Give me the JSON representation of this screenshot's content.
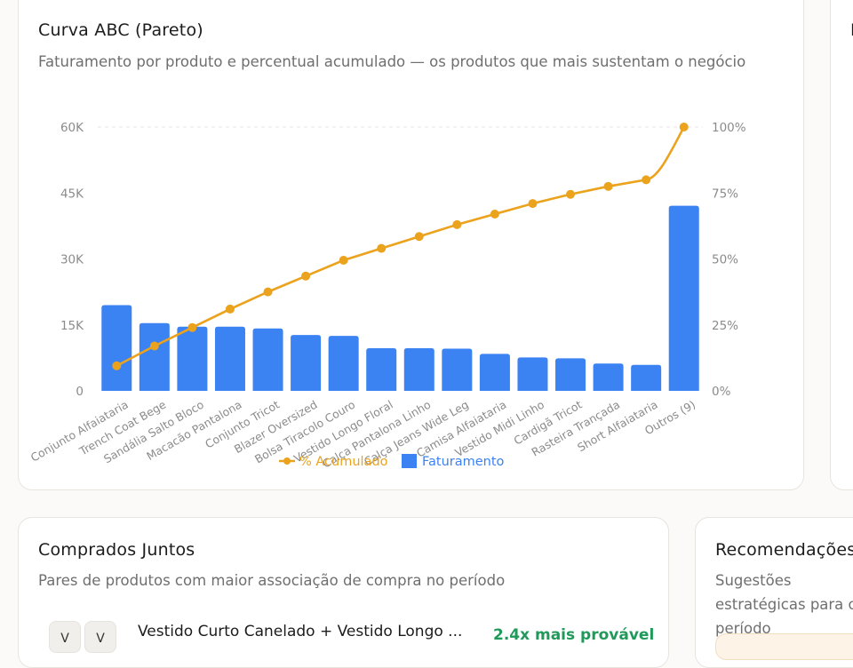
{
  "abc_card": {
    "title": "Curva ABC (Pareto)",
    "subtitle": "Faturamento por produto e percentual acumulado — os produtos que mais sustentam o negócio"
  },
  "right_card": {
    "title": "I"
  },
  "bought_card": {
    "title": "Comprados Juntos",
    "subtitle": "Pares de produtos com maior associação de compra no período",
    "pair": {
      "thumb_a": "V",
      "thumb_b": "V",
      "name": "Vestido Curto Canelado + Vestido Longo ...",
      "lift": "2.4x mais provável"
    }
  },
  "recs_card": {
    "title": "Recomendações",
    "subtitle": "Sugestões estratégicas para o período"
  },
  "colors": {
    "bar": "#3b82f2",
    "line": "#eba21c",
    "axis_text": "#8b8b8b",
    "grid": "#e6e6e6"
  },
  "chart_data": {
    "type": "bar",
    "categories": [
      "Conjunto Alfaiataria",
      "Trench Coat Bege",
      "Sandália Salto Bloco",
      "Macacão Pantalona",
      "Conjunto Tricot",
      "Blazer Oversized",
      "Bolsa Tiracolo Couro",
      "Vestido Longo Floral",
      "Calça Pantalona Linho",
      "Calça Jeans Wide Leg",
      "Camisa Alfaiataria",
      "Vestido Midi Linho",
      "Cardigã Tricot",
      "Rasteira Trançada",
      "Short Alfaiataria",
      "Outros (9)"
    ],
    "series": [
      {
        "name": "Faturamento",
        "axis": "left",
        "kind": "bar",
        "values": [
          19500,
          15400,
          14600,
          14600,
          14200,
          12700,
          12500,
          9700,
          9700,
          9600,
          8400,
          7600,
          7400,
          6200,
          5900,
          42100
        ]
      },
      {
        "name": "% Acumulado",
        "axis": "right",
        "kind": "line",
        "values": [
          9.5,
          17,
          24,
          31,
          37.5,
          43.5,
          49.5,
          54,
          58.5,
          63,
          67,
          71,
          74.5,
          77.5,
          80,
          100
        ]
      }
    ],
    "ylim": [
      0,
      60000
    ],
    "y_ticks": [
      "0",
      "15K",
      "30K",
      "45K",
      "60K"
    ],
    "y2lim": [
      0,
      100
    ],
    "y2_ticks": [
      "0%",
      "25%",
      "50%",
      "75%",
      "100%"
    ],
    "grid": "dashed top line only",
    "legend": "bottom-center"
  }
}
